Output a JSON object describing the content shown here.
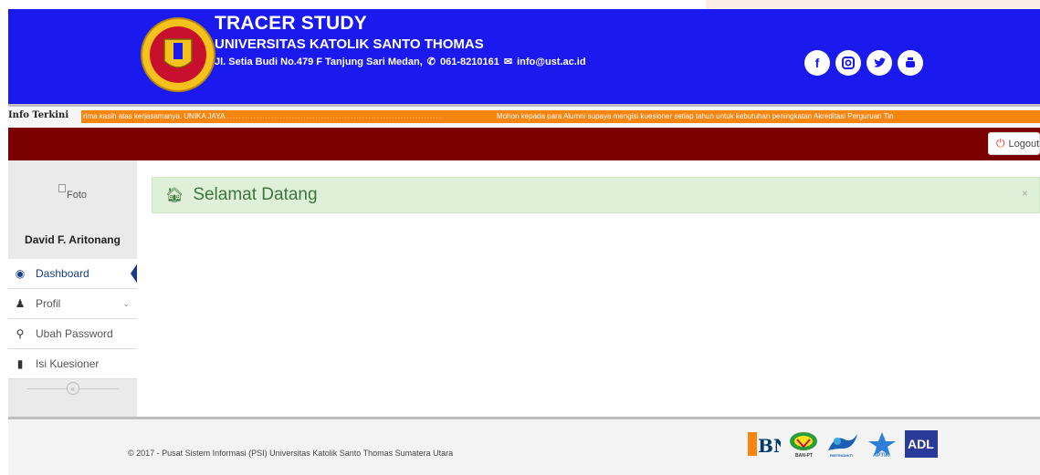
{
  "header": {
    "title": "TRACER STUDY",
    "university": "UNIVERSITAS KATOLIK SANTO THOMAS",
    "address": "Jl. Setia Budi No.479 F Tanjung Sari Medan,",
    "phone": "061-8210161",
    "email": "info@ust.ac.id",
    "socials": [
      "facebook-icon",
      "instagram-icon",
      "twitter-icon",
      "youtube-icon"
    ],
    "bg_color": "#1a1aee"
  },
  "ticker": {
    "label": "Info Terkini",
    "message_a": "rima kasih atas kerjasamanya. UNIKA JAYA",
    "message_b": "Mohon kepada para Alumni supaya mengisi kuesioner setiap tahun untuk kebutuhan peningkatan Akreditasi Perguruan Tin",
    "bar_color": "#f7850f"
  },
  "topbar": {
    "logout_label": "Logout",
    "bg_color": "#7b0000"
  },
  "sidebar": {
    "photo_alt": "Foto",
    "user_name": "David F. Aritonang",
    "items": [
      {
        "label": "Dashboard",
        "icon": "dashboard-icon",
        "active": true
      },
      {
        "label": "Profil",
        "icon": "user-icon",
        "has_submenu": true
      },
      {
        "label": "Ubah Password",
        "icon": "key-icon"
      },
      {
        "label": "Isi Kuesioner",
        "icon": "file-icon"
      }
    ],
    "collapse_glyph": "«"
  },
  "main": {
    "welcome": "Selamat Datang",
    "close_glyph": "×"
  },
  "footer": {
    "copyright": "© 2017 - Pusat Sistem Informasi (PSI) Universitas Katolik Santo Thomas Sumatera Utara",
    "partners": [
      "BNI",
      "BAN-PT",
      "RISTEKDIKTI",
      "APTIK",
      "ADL"
    ]
  }
}
